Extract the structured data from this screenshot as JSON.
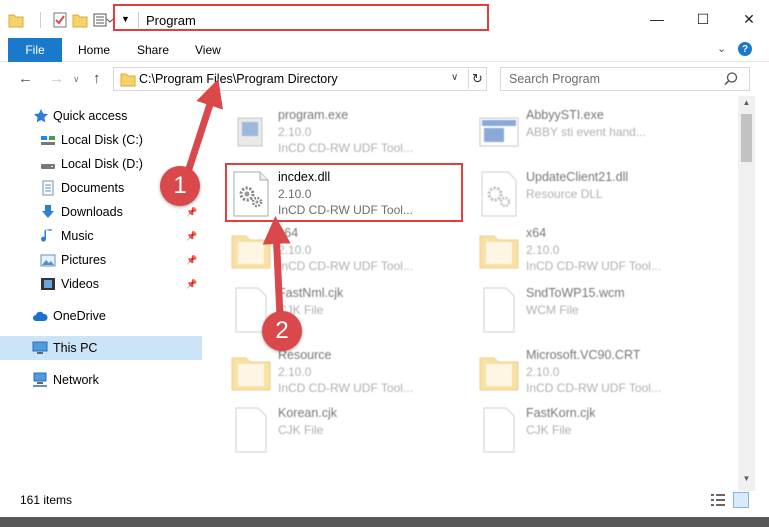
{
  "window": {
    "title": "Program",
    "min_glyph": "—",
    "max_glyph": "☐",
    "close_glyph": "✕"
  },
  "ribbon": {
    "tabs": [
      {
        "label": "File"
      },
      {
        "label": "Home"
      },
      {
        "label": "Share"
      },
      {
        "label": "View"
      }
    ],
    "help_glyph": "?"
  },
  "nav": {
    "address_path": "C:\\Program Files\\Program Directory",
    "search_placeholder": "Search Program"
  },
  "sidebar": {
    "items": [
      {
        "label": "Quick access",
        "icon": "star-icon"
      },
      {
        "label": "Local Disk (C:)",
        "icon": "drive-icon"
      },
      {
        "label": "Local Disk (D:)",
        "icon": "drive-icon"
      },
      {
        "label": "Documents",
        "icon": "documents-icon"
      },
      {
        "label": "Downloads",
        "icon": "downloads-icon"
      },
      {
        "label": "Music",
        "icon": "music-icon"
      },
      {
        "label": "Pictures",
        "icon": "pictures-icon"
      },
      {
        "label": "Videos",
        "icon": "videos-icon"
      },
      {
        "label": "OneDrive",
        "icon": "cloud-icon"
      },
      {
        "label": "This PC",
        "icon": "computer-icon"
      },
      {
        "label": "Network",
        "icon": "network-icon"
      }
    ]
  },
  "files": [
    {
      "name": "program.exe",
      "line2": "2.10.0",
      "line3": "InCD CD-RW UDF Tool..."
    },
    {
      "name": "AbbyySTI.exe",
      "line2": "ABBY sti event hand...",
      "line3": ""
    },
    {
      "name": "incdex.dll",
      "line2": "2.10.0",
      "line3": "InCD CD-RW UDF Tool..."
    },
    {
      "name": "UpdateClient21.dll",
      "line2": "Resource DLL",
      "line3": ""
    },
    {
      "name": "x64",
      "line2": "2.10.0",
      "line3": "InCD CD-RW UDF Tool..."
    },
    {
      "name": "x64",
      "line2": "2.10.0",
      "line3": "InCD CD-RW UDF Tool..."
    },
    {
      "name": "FastNml.cjk",
      "line2": "CJK File",
      "line3": ""
    },
    {
      "name": "SndToWP15.wcm",
      "line2": "WCM File",
      "line3": ""
    },
    {
      "name": "Resource",
      "line2": "2.10.0",
      "line3": "InCD CD-RW UDF Tool..."
    },
    {
      "name": "Microsoft.VC90.CRT",
      "line2": "2.10.0",
      "line3": "InCD CD-RW UDF Tool..."
    },
    {
      "name": "Korean.cjk",
      "line2": "CJK File",
      "line3": ""
    },
    {
      "name": "FastKorn.cjk",
      "line2": "CJK File",
      "line3": ""
    }
  ],
  "status": {
    "item_count": "161 items"
  },
  "annotations": {
    "badge1": "1",
    "badge2": "2",
    "color": "#e23e3e"
  },
  "colors": {
    "accent": "#1979ca",
    "selection": "#cce4f7",
    "highlight": "#e23e3e"
  }
}
